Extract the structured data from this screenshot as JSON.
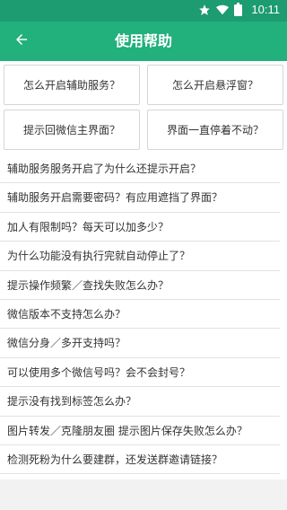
{
  "status_bar": {
    "time": "10:11",
    "icons": [
      "star-icon",
      "wifi-icon",
      "battery-icon"
    ]
  },
  "app_bar": {
    "title": "使用帮助",
    "back_icon": "arrow-left-icon",
    "color": "#22b07d"
  },
  "quick_questions": [
    "怎么开启辅助服务？",
    "怎么开启悬浮窗？",
    "提示回微信主界面？",
    "界面一直停着不动？"
  ],
  "faq": [
    "辅助服务服务开启了为什么还提示开启？",
    "辅助服务开启需要密码？有应用遮挡了界面？",
    "加人有限制吗？每天可以加多少？",
    "为什么功能没有执行完就自动停止了？",
    "提示操作频繁／查找失败怎么办？",
    "微信版本不支持怎么办？",
    "微信分身／多开支持吗？",
    "可以使用多个微信号吗？会不会封号？",
    "提示没有找到标签怎么办？",
    "图片转发／克隆朋友圈 提示图片保存失败怎么办？",
    "检测死粉为什么要建群，还发送群邀请链接？"
  ]
}
